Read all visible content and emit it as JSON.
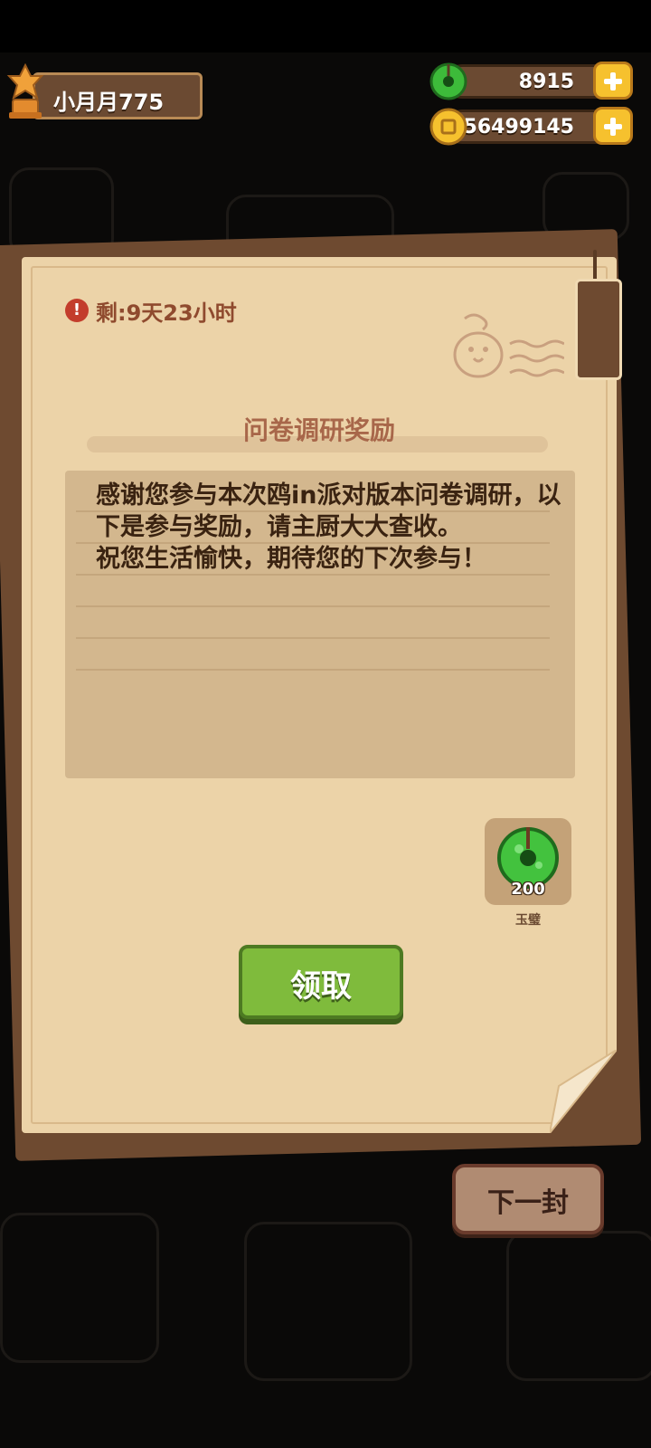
{
  "player": {
    "name": "小月月775"
  },
  "currencies": {
    "jade": {
      "value": "8915",
      "icon": "jade-disc-icon"
    },
    "coin": {
      "value": "56499145",
      "icon": "coin-icon"
    }
  },
  "letter": {
    "timer": "剩:9天23小时",
    "title": "问卷调研奖励",
    "message": "感谢您参与本次鸥in派对版本问卷调研，以下是参与奖励，请主厨大大查收。\n祝您生活愉快，期待您的下次参与！",
    "reward": {
      "count": "200",
      "name": "玉璧",
      "icon": "jade-disc-icon"
    },
    "claim_label": "领取"
  },
  "next_label": "下一封",
  "colors": {
    "paper": "#ecd3a8",
    "accent_green": "#7fbb3c",
    "text_brown": "#3a2311",
    "title_brown": "#a8674a"
  }
}
